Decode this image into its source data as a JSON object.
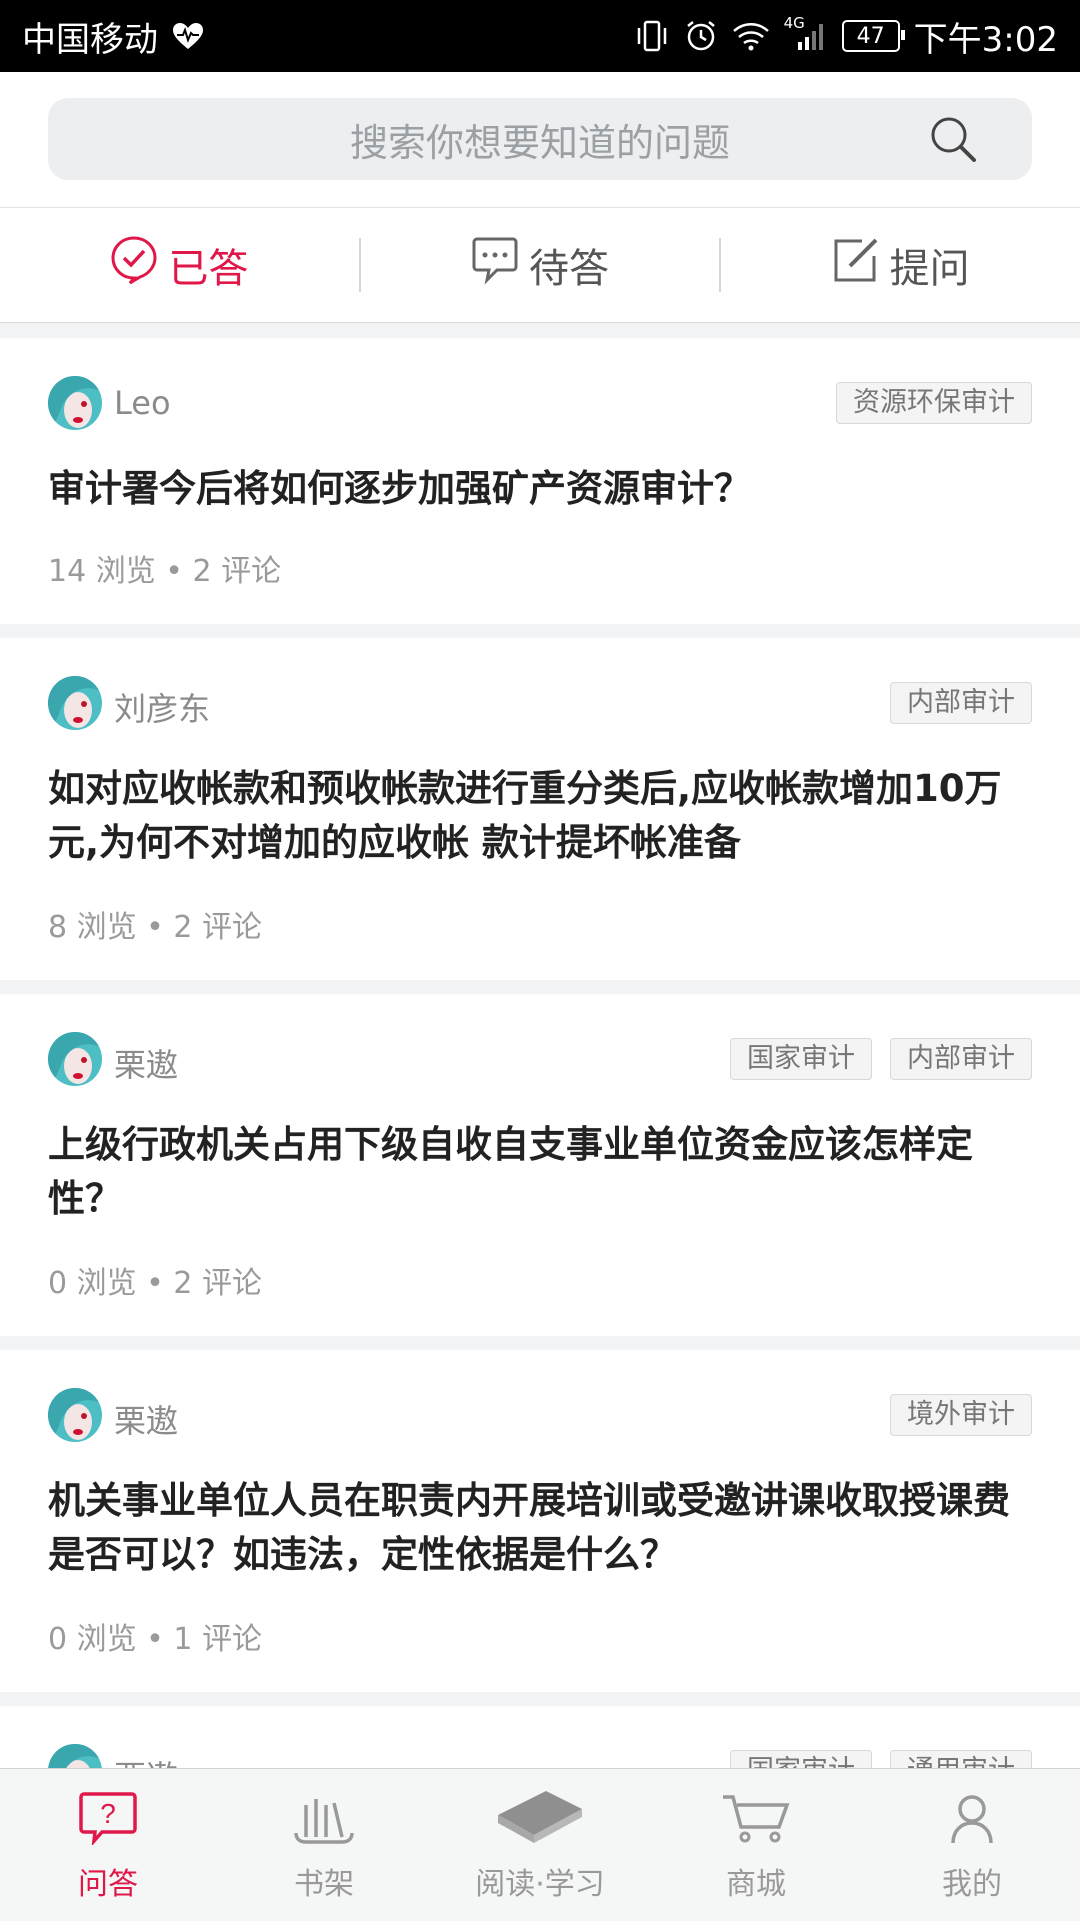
{
  "status_bar": {
    "carrier": "中国移动",
    "network": "4G",
    "battery": "47",
    "time": "下午3:02"
  },
  "search": {
    "placeholder": "搜索你想要知道的问题"
  },
  "tabs": [
    {
      "label": "已答",
      "icon": "check-circle-icon",
      "active": true
    },
    {
      "label": "待答",
      "icon": "chat-bubble-icon",
      "active": false
    },
    {
      "label": "提问",
      "icon": "edit-icon",
      "active": false
    }
  ],
  "questions": [
    {
      "author": "Leo",
      "tags": [
        "资源环保审计"
      ],
      "title": "审计署今后将如何逐步加强矿产资源审计？",
      "meta": "14 浏览 • 2 评论"
    },
    {
      "author": "刘彦东",
      "tags": [
        "内部审计"
      ],
      "title": "如对应收帐款和预收帐款进行重分类后,应收帐款增加10万元,为何不对增加的应收帐 款计提坏帐准备",
      "meta": "8 浏览 • 2 评论"
    },
    {
      "author": "栗遨",
      "tags": [
        "国家审计",
        "内部审计"
      ],
      "title": "上级行政机关占用下级自收自支事业单位资金应该怎样定性？",
      "meta": "0 浏览 • 2 评论"
    },
    {
      "author": "栗遨",
      "tags": [
        "境外审计"
      ],
      "title": "机关事业单位人员在职责内开展培训或受邀讲课收取授课费是否可以？如违法，定性依据是什么？",
      "meta": "0 浏览 • 1 评论"
    },
    {
      "author": "栗遨",
      "tags": [
        "国家审计",
        "通用审计"
      ],
      "title": "",
      "meta": ""
    }
  ],
  "bottom_nav": [
    {
      "label": "问答",
      "icon": "question-bubble-icon",
      "active": true
    },
    {
      "label": "书架",
      "icon": "bookshelf-icon",
      "active": false
    },
    {
      "label": "阅读·学习",
      "icon": "book-icon",
      "active": false
    },
    {
      "label": "商城",
      "icon": "cart-icon",
      "active": false
    },
    {
      "label": "我的",
      "icon": "user-icon",
      "active": false
    }
  ],
  "colors": {
    "accent": "#e0184a",
    "avatar": "#4dbfc4"
  }
}
